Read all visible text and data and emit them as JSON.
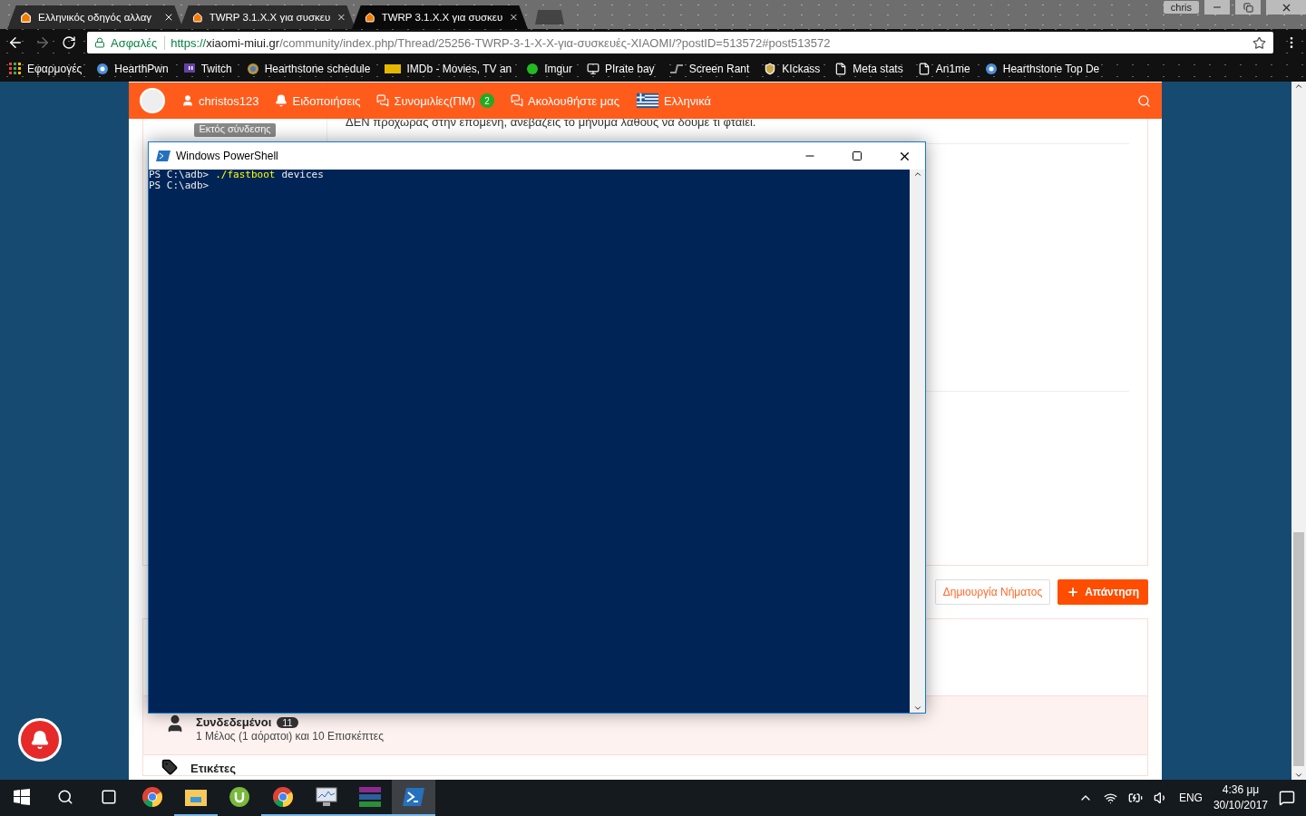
{
  "browser": {
    "profile": "chris",
    "tabs": [
      {
        "title": "Ελληνικός οδηγός αλλαγ",
        "selected": false
      },
      {
        "title": "TWRP 3.1.X.X για συσκευ",
        "selected": false
      },
      {
        "title": "TWRP 3.1.X.X για συσκευ",
        "selected": true
      }
    ],
    "address": {
      "secure_label": "Ασφαλές",
      "scheme": "https://",
      "host": "xiaomi-miui.gr",
      "path": "/community/index.php/Thread/25256-TWRP-3-1-X-X-για-συσκευές-XIAOMI/?postID=513572#post513572"
    },
    "bookmarks": [
      {
        "label": "Εφαρμογές",
        "kind": "apps"
      },
      {
        "label": "HearthPwn",
        "kind": "swirl"
      },
      {
        "label": "Twitch",
        "kind": "twitch"
      },
      {
        "label": "Hearthstone schedule",
        "kind": "gear"
      },
      {
        "label": "IMDb - Movies, TV an",
        "kind": "imdb"
      },
      {
        "label": "Imgur",
        "kind": "dot"
      },
      {
        "label": "PIrate bay",
        "kind": "monitor"
      },
      {
        "label": "Screen Rant",
        "kind": "sr"
      },
      {
        "label": "KIckass",
        "kind": "shield"
      },
      {
        "label": "Meta stats",
        "kind": "page"
      },
      {
        "label": "An1me",
        "kind": "page"
      },
      {
        "label": "Hearthstone Top De",
        "kind": "swirl"
      }
    ]
  },
  "site": {
    "nav": [
      {
        "label": "christos123",
        "kind": "user"
      },
      {
        "label": "Ειδοποιήσεις",
        "kind": "bell"
      },
      {
        "label": "Συνομιλίες(ΠΜ)",
        "kind": "chat",
        "badge": "2"
      },
      {
        "label": "Ακολουθήστε μας",
        "kind": "chat"
      },
      {
        "label": "Ελληνικά",
        "kind": "flag"
      }
    ],
    "author_status": "Εκτός σύνδεσης",
    "post_lines": [
      "ΔΕΝ προχωράς στην επόμενη, ανεβάζεις το μήνυμα λάθους να δούμε τι φταίει."
    ],
    "buttons": [
      {
        "label": "Δημιουργία Νήματος",
        "kind": "outline"
      },
      {
        "label": "Απάντηση",
        "kind": "primary"
      }
    ],
    "online": {
      "title": "Συνδεδεμένοι",
      "count": "11",
      "summary": "1 Μέλος (1 αόρατοι) και 10 Επισκέπτες"
    },
    "tags_title": "Ετικέτες"
  },
  "powershell": {
    "title": "Windows PowerShell",
    "lines": [
      {
        "prompt": "PS C:\\adb>",
        "command": "./fastboot",
        "args": "devices"
      },
      {
        "prompt": "PS C:\\adb>"
      }
    ]
  },
  "taskbar": {
    "apps": [
      {
        "kind": "chrome",
        "running": false,
        "selected": false
      },
      {
        "kind": "explorer",
        "running": true,
        "selected": false
      },
      {
        "kind": "utorrent",
        "running": false,
        "selected": false
      },
      {
        "kind": "chrome",
        "running": true,
        "selected": false
      },
      {
        "kind": "monitor",
        "running": true,
        "selected": false
      },
      {
        "kind": "winrar",
        "running": true,
        "selected": false
      },
      {
        "kind": "powershell",
        "running": true,
        "selected": true
      }
    ],
    "language": "ENG",
    "time": "4:36 μμ",
    "date": "30/10/2017"
  }
}
